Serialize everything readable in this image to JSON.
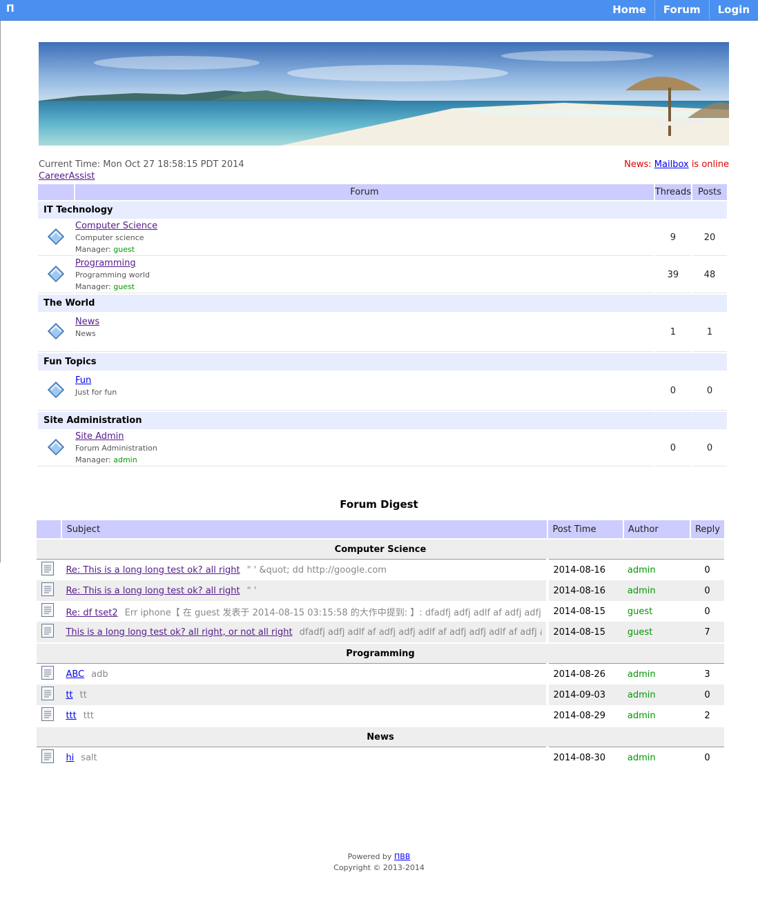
{
  "header": {
    "brand": "П",
    "nav": [
      "Home",
      "Forum",
      "Login"
    ]
  },
  "info": {
    "current_time": "Current Time: Mon Oct 27 18:58:15 PDT 2014",
    "career_link": "CareerAssist",
    "news_prefix": "News: ",
    "news_link": "Mailbox",
    "news_suffix": " is online"
  },
  "forum_table": {
    "columns": [
      "Forum",
      "Threads",
      "Posts"
    ],
    "categories": [
      {
        "name": "IT Technology",
        "forums": [
          {
            "name": "Computer Science",
            "desc": "Computer science",
            "manager_label": "Manager: ",
            "manager": "guest",
            "threads": "9",
            "posts": "20"
          },
          {
            "name": "Programming",
            "desc": "Programming world",
            "manager_label": "Manager: ",
            "manager": "guest",
            "threads": "39",
            "posts": "48"
          }
        ]
      },
      {
        "name": "The World",
        "forums": [
          {
            "name": "News",
            "desc": "News",
            "manager_label": "",
            "manager": "",
            "threads": "1",
            "posts": "1"
          }
        ]
      },
      {
        "name": "Fun Topics",
        "forums": [
          {
            "name": "Fun",
            "desc": "Just for fun",
            "manager_label": "",
            "manager": "",
            "threads": "0",
            "posts": "0"
          }
        ]
      },
      {
        "name": "Site Administration",
        "forums": [
          {
            "name": "Site Admin",
            "desc": "Forum Administration",
            "manager_label": "Manager: ",
            "manager": "admin",
            "threads": "0",
            "posts": "0"
          }
        ]
      }
    ]
  },
  "digest": {
    "title": "Forum Digest",
    "columns": [
      "Subject",
      "Post Time",
      "Author",
      "Reply"
    ],
    "sections": [
      {
        "name": "Computer Science",
        "rows": [
          {
            "subject": "Re: This is a long long test ok? all right",
            "excerpt": "\" ' &quot;  dd http://google.com",
            "time": "2014-08-16",
            "author": "admin",
            "reply": "0",
            "visited": true
          },
          {
            "subject": "Re: This is a long long test ok? all right",
            "excerpt": "\" '",
            "time": "2014-08-16",
            "author": "admin",
            "reply": "0",
            "visited": true
          },
          {
            "subject": "Re: df tset2",
            "excerpt": "Err iphone【 在 guest 发表于 2014-08-15 03:15:58 的大作中提到: 】: dfadfj adfj adlf af adfj adfj adlf",
            "time": "2014-08-15",
            "author": "guest",
            "reply": "0",
            "visited": true
          },
          {
            "subject": "This is a long long test ok? all right, or not all right",
            "excerpt": "dfadfj adfj adlf af adfj adfj adlf af adfj adfj adlf af adfj adfj",
            "time": "2014-08-15",
            "author": "guest",
            "reply": "7",
            "visited": true
          }
        ]
      },
      {
        "name": "Programming",
        "rows": [
          {
            "subject": "ABC",
            "excerpt": "adb",
            "time": "2014-08-26",
            "author": "admin",
            "reply": "3",
            "visited": false
          },
          {
            "subject": "tt",
            "excerpt": "tt",
            "time": "2014-09-03",
            "author": "admin",
            "reply": "0",
            "visited": false
          },
          {
            "subject": "ttt",
            "excerpt": "ttt",
            "time": "2014-08-29",
            "author": "admin",
            "reply": "2",
            "visited": false
          }
        ]
      },
      {
        "name": "News",
        "rows": [
          {
            "subject": "hi",
            "excerpt": "salt",
            "time": "2014-08-30",
            "author": "admin",
            "reply": "0",
            "visited": false
          }
        ]
      }
    ]
  },
  "footer": {
    "powered_prefix": "Powered by ",
    "powered_link": "ПВВ",
    "copyright": "Copyright © 2013-2014"
  },
  "colors": {
    "topbar": "#4a90f0",
    "table_header": "#ccccff",
    "category_row": "#e8ecff",
    "author_green": "#009900",
    "news_red": "#e00000"
  }
}
